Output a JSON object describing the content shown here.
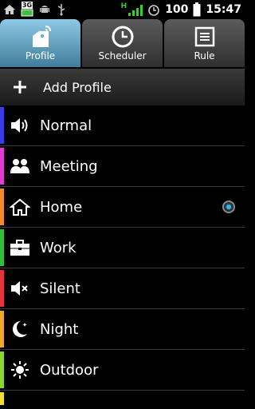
{
  "status_bar": {
    "network_label": "3G",
    "data_label": "H",
    "battery_level": "100",
    "time": "15:47",
    "icons": [
      "home-icon",
      "sd-card-icon",
      "android-icon",
      "usb-icon",
      "signal-icon",
      "alarm-icon",
      "battery-icon"
    ]
  },
  "tabs": [
    {
      "label": "Profile",
      "icon": "profile-tag-icon",
      "active": true
    },
    {
      "label": "Scheduler",
      "icon": "clock-icon",
      "active": false
    },
    {
      "label": "Rule",
      "icon": "list-icon",
      "active": false
    }
  ],
  "add_profile": {
    "label": "Add Profile",
    "icon": "plus-icon"
  },
  "profiles": [
    {
      "label": "Normal",
      "icon": "speaker-icon",
      "color": "#3a3ae8",
      "selected": false
    },
    {
      "label": "Meeting",
      "icon": "people-icon",
      "color": "#e23ad0",
      "selected": false
    },
    {
      "label": "Home",
      "icon": "house-icon",
      "color": "#f08a2a",
      "selected": true
    },
    {
      "label": "Work",
      "icon": "briefcase-icon",
      "color": "#2fbf3a",
      "selected": false
    },
    {
      "label": "Silent",
      "icon": "speaker-muted-icon",
      "color": "#e8323a",
      "selected": false
    },
    {
      "label": "Night",
      "icon": "moon-icon",
      "color": "#f0a82a",
      "selected": false
    },
    {
      "label": "Outdoor",
      "icon": "sun-icon",
      "color": "#8ad62a",
      "selected": false
    }
  ],
  "colors": {
    "accent": "#34b5e5",
    "tab_active": "#5fa6c8",
    "tab_inactive": "#404040"
  }
}
